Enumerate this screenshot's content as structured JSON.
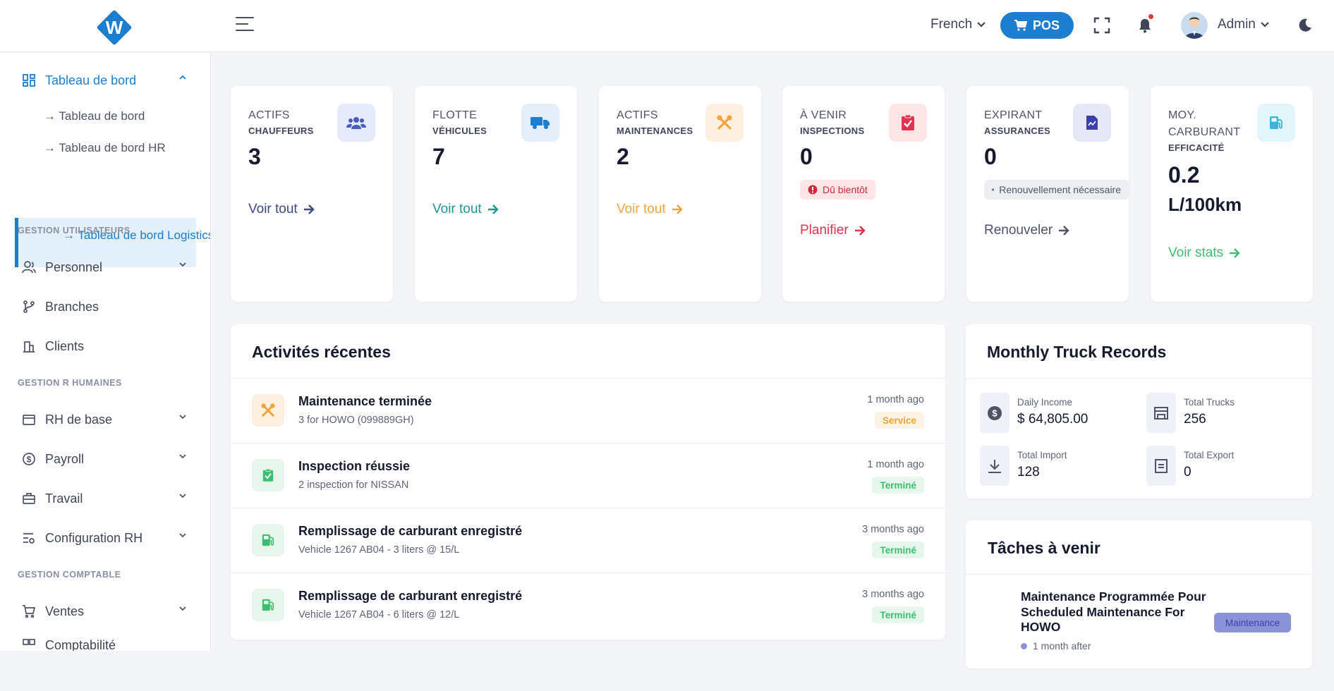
{
  "colors": {
    "primary": "#1b7ed1",
    "danger": "#e2324f",
    "warning": "#f0a43a",
    "success": "#3cbf6e",
    "teal": "#1a9a8f"
  },
  "header": {
    "language": "French",
    "pos_label": "POS",
    "user_name": "Admin",
    "icons": [
      "fullscreen-icon",
      "bell-icon",
      "moon-icon"
    ]
  },
  "sidebar": {
    "dashboard": {
      "label": "Tableau de bord",
      "children": [
        "Tableau de bord",
        "Tableau de bord HR",
        "Tableau de bord Logistics"
      ]
    },
    "sections": {
      "users": "GESTION UTILISATEURS",
      "hr": "GESTION R HUMAINES",
      "accounting": "GESTION COMPTABLE"
    },
    "items": {
      "personnel": "Personnel",
      "branches": "Branches",
      "clients": "Clients",
      "rh_base": "RH de base",
      "payroll": "Payroll",
      "travail": "Travail",
      "config_rh": "Configuration RH",
      "ventes": "Ventes",
      "comptabilite": "Comptabilité"
    }
  },
  "stats": [
    {
      "label": "ACTIFS",
      "sublabel": "CHAUFFEURS",
      "value": "3",
      "link": "Voir tout",
      "icon": "users-icon"
    },
    {
      "label": "FLOTTE",
      "sublabel": "VÉHICULES",
      "value": "7",
      "link": "Voir tout",
      "icon": "truck-icon"
    },
    {
      "label": "ACTIFS",
      "sublabel": "MAINTENANCES",
      "value": "2",
      "link": "Voir tout",
      "icon": "tools-icon"
    },
    {
      "label": "À VENIR",
      "sublabel": "INSPECTIONS",
      "value": "0",
      "badge": "Dû bientôt",
      "link": "Planifier",
      "icon": "clipboard-check-icon"
    },
    {
      "label": "EXPIRANT",
      "sublabel": "ASSURANCES",
      "value": "0",
      "badge": "Renouvellement nécessaire",
      "link": "Renouveler",
      "icon": "document-icon"
    },
    {
      "label": "MOY.",
      "label2": "CARBURANT",
      "sublabel": "EFFICACITÉ",
      "value": "0.2",
      "value2": "L/100km",
      "link": "Voir stats",
      "icon": "fuel-pump-icon"
    }
  ],
  "activities": {
    "title": "Activités récentes",
    "items": [
      {
        "title": "Maintenance terminée",
        "desc": "3 for HOWO (099889GH)",
        "time": "1 month ago",
        "badge": "Service",
        "icon": "tools-icon"
      },
      {
        "title": "Inspection réussie",
        "desc": "2 inspection for NISSAN",
        "time": "1 month ago",
        "badge": "Terminé",
        "icon": "clipboard-check-icon"
      },
      {
        "title": "Remplissage de carburant enregistré",
        "desc": "Vehicle 1267 AB04 - 3 liters @ 15/L",
        "time": "3 months ago",
        "badge": "Terminé",
        "icon": "fuel-pump-icon"
      },
      {
        "title": "Remplissage de carburant enregistré",
        "desc": "Vehicle 1267 AB04 - 6 liters @ 12/L",
        "time": "3 months ago",
        "badge": "Terminé",
        "icon": "fuel-pump-icon"
      }
    ]
  },
  "truck_records": {
    "title": "Monthly Truck Records",
    "metrics": [
      {
        "label": "Daily Income",
        "value": "$ 64,805.00",
        "icon": "dollar-icon"
      },
      {
        "label": "Total Trucks",
        "value": "256",
        "icon": "store-icon"
      },
      {
        "label": "Total Import",
        "value": "128",
        "icon": "download-icon"
      },
      {
        "label": "Total Export",
        "value": "0",
        "icon": "document-icon"
      }
    ]
  },
  "tasks": {
    "title": "Tâches à venir",
    "items": [
      {
        "title": "Maintenance Programmée Pour Scheduled Maintenance For HOWO",
        "time": "1 month after",
        "badge": "Maintenance"
      }
    ]
  }
}
